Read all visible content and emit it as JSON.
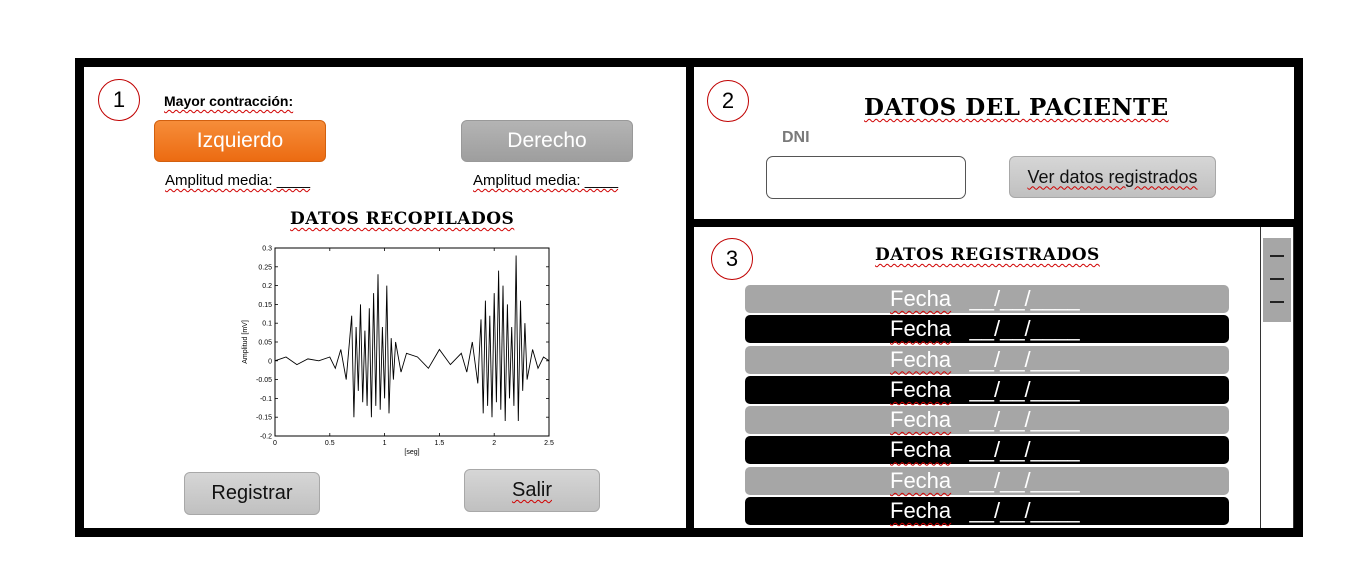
{
  "section1": {
    "number": "1",
    "mayor_label": "Mayor contracción:",
    "left_button": "Izquierdo",
    "right_button": "Derecho",
    "left_amplitude": "Amplitud media: ____",
    "right_amplitude": "Amplitud media: ____",
    "collected_title": "DATOS RECOPILADOS",
    "register_button": "Registrar",
    "exit_button": "Salir"
  },
  "section2": {
    "number": "2",
    "title": "DATOS DEL PACIENTE",
    "dni_label": "DNI",
    "dni_value": "",
    "view_button": "Ver datos registrados"
  },
  "section3": {
    "number": "3",
    "title": "DATOS REGISTRADOS",
    "records": [
      {
        "label": "Fecha",
        "date": "__/__/____"
      },
      {
        "label": "Fecha",
        "date": "__/__/____"
      },
      {
        "label": "Fecha",
        "date": "__/__/____"
      },
      {
        "label": "Fecha",
        "date": "__/__/____"
      },
      {
        "label": "Fecha",
        "date": "__/__/____"
      },
      {
        "label": "Fecha",
        "date": "__/__/____"
      },
      {
        "label": "Fecha",
        "date": "__/__/____"
      },
      {
        "label": "Fecha",
        "date": "__/__/____"
      }
    ]
  },
  "colors": {
    "accent_orange": "#ed7d31",
    "button_gray": "#a6a6a6",
    "circle_red": "#c00000"
  },
  "chart_data": {
    "type": "line",
    "title": "",
    "xlabel": "[seg]",
    "ylabel": "Amplitud [mV]",
    "xlim": [
      0,
      2.5
    ],
    "ylim": [
      -0.2,
      0.3
    ],
    "x_ticks": [
      "0",
      "0.5",
      "1",
      "1.5",
      "2",
      "2.5"
    ],
    "y_ticks": [
      "0.3",
      "0.25",
      "0.2",
      "0.15",
      "0.1",
      "0.05",
      "0",
      "-0.05",
      "-0.1",
      "-0.15",
      "-0.2"
    ],
    "series": [
      {
        "x": [
          0,
          0.1,
          0.2,
          0.3,
          0.4,
          0.5,
          0.55,
          0.6,
          0.65,
          0.7,
          0.72,
          0.74,
          0.76,
          0.78,
          0.8,
          0.82,
          0.84,
          0.86,
          0.88,
          0.9,
          0.92,
          0.94,
          0.96,
          0.98,
          1.0,
          1.02,
          1.04,
          1.06,
          1.08,
          1.1,
          1.15,
          1.2,
          1.3,
          1.4,
          1.5,
          1.6,
          1.7,
          1.75,
          1.8,
          1.85,
          1.88,
          1.9,
          1.92,
          1.94,
          1.96,
          1.98,
          2.0,
          2.02,
          2.04,
          2.06,
          2.08,
          2.1,
          2.12,
          2.14,
          2.16,
          2.18,
          2.2,
          2.22,
          2.24,
          2.26,
          2.28,
          2.3,
          2.35,
          2.4,
          2.45,
          2.5
        ],
        "y": [
          0,
          0.01,
          -0.01,
          0.005,
          0,
          0.01,
          -0.02,
          0.03,
          -0.05,
          0.12,
          -0.15,
          0.09,
          -0.08,
          0.15,
          -0.11,
          0.08,
          -0.12,
          0.14,
          -0.15,
          0.18,
          -0.12,
          0.23,
          -0.13,
          0.09,
          -0.1,
          0.2,
          -0.14,
          0.06,
          -0.05,
          0.05,
          -0.03,
          0.02,
          0.01,
          -0.02,
          0.03,
          -0.01,
          0.02,
          -0.03,
          0.05,
          -0.06,
          0.11,
          -0.14,
          0.16,
          -0.12,
          0.12,
          -0.15,
          0.18,
          -0.11,
          0.24,
          -0.13,
          0.2,
          -0.16,
          0.15,
          -0.1,
          0.09,
          -0.12,
          0.28,
          -0.16,
          0.16,
          -0.08,
          0.1,
          -0.05,
          0.03,
          -0.02,
          0.01,
          0.0
        ]
      }
    ]
  }
}
